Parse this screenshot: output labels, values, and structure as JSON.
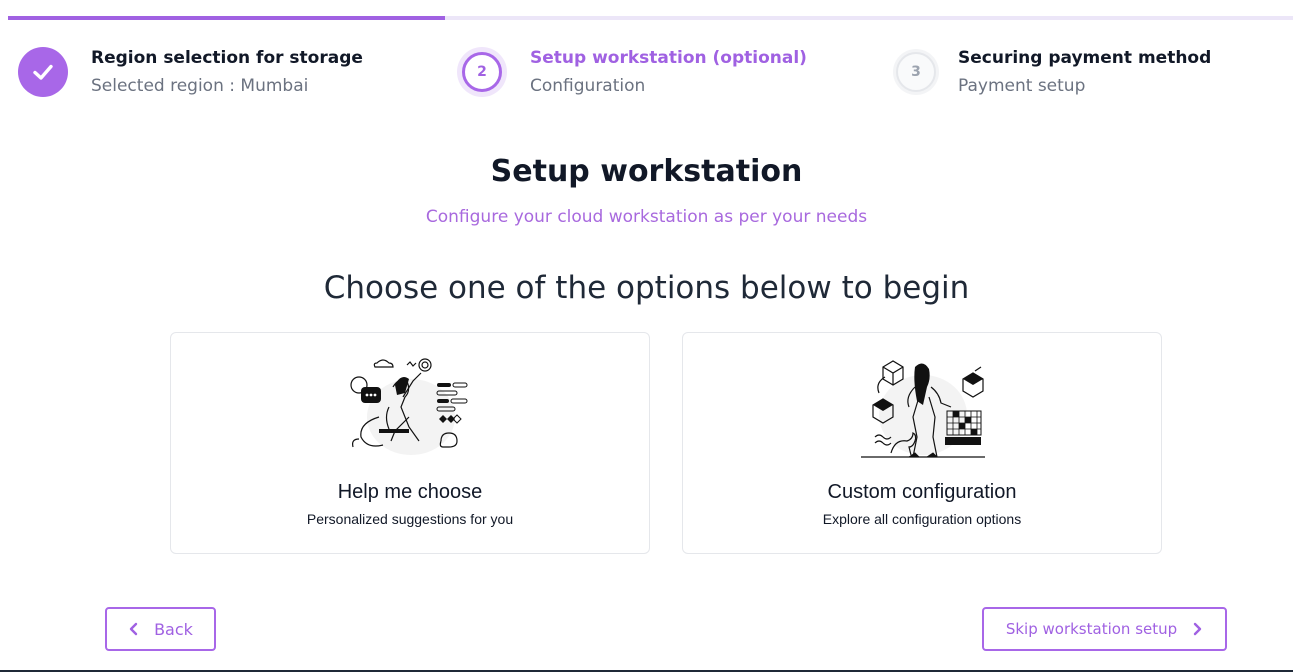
{
  "progress": {
    "fraction": 0.34
  },
  "steps": [
    {
      "title": "Region selection for storage",
      "subtitle": "Selected region : Mumbai",
      "status": "done",
      "icon": "check-icon"
    },
    {
      "number": "2",
      "title": "Setup workstation (optional)",
      "subtitle": "Configuration",
      "status": "active"
    },
    {
      "number": "3",
      "title": "Securing payment method",
      "subtitle": "Payment setup",
      "status": "pending"
    }
  ],
  "page": {
    "title": "Setup workstation",
    "subtitle": "Configure your cloud workstation as per your needs",
    "choose_heading": "Choose one of the options below to begin"
  },
  "options": [
    {
      "title": "Help me choose",
      "description": "Personalized suggestions for you",
      "icon": "person-with-ideas-illustration"
    },
    {
      "title": "Custom configuration",
      "description": "Explore all configuration options",
      "icon": "person-with-cubes-illustration"
    }
  ],
  "buttons": {
    "back": "Back",
    "skip": "Skip workstation setup"
  },
  "colors": {
    "accent": "#a867e8",
    "accent_text": "#a061e2",
    "subtitle_text": "#a869de"
  }
}
